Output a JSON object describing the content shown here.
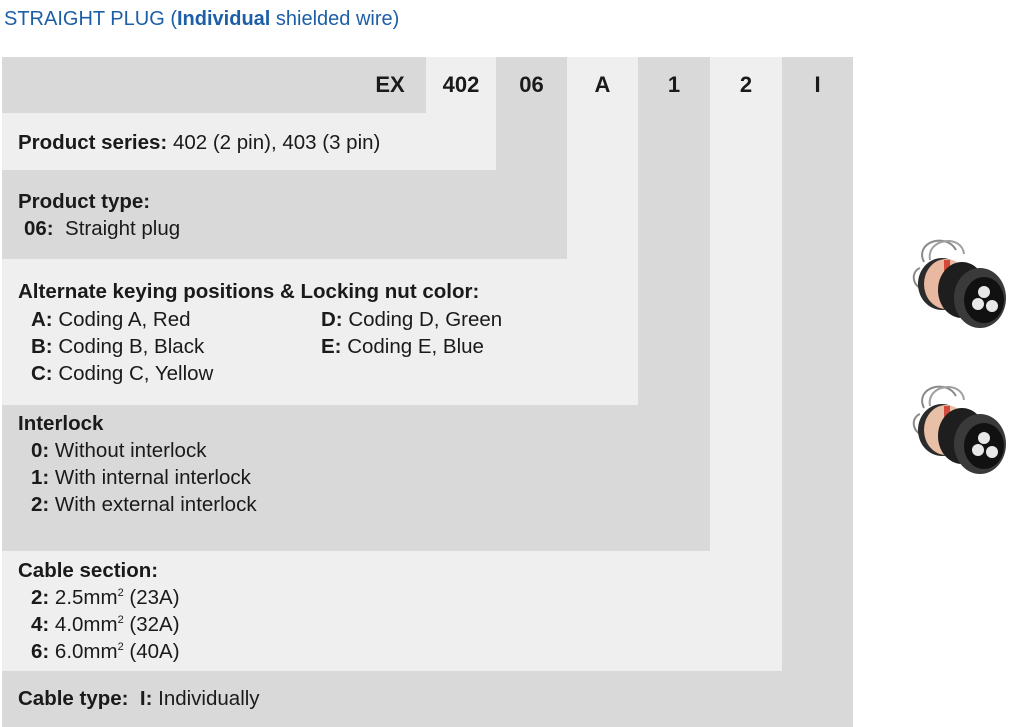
{
  "title": {
    "prefix": "STRAIGHT PLUG (",
    "bold": "Individual",
    "suffix": " shielded wire)"
  },
  "header": {
    "cells": [
      "EX",
      "402",
      "06",
      "A",
      "1",
      "2",
      "I"
    ]
  },
  "series": {
    "label": "Product series:",
    "value": " 402 (2 pin), 403 (3 pin)"
  },
  "type": {
    "label": "Product type:",
    "code": "06:",
    "desc": "  Straight plug"
  },
  "keying": {
    "heading": "Alternate keying positions & Locking nut color:",
    "left": [
      {
        "code": "A:",
        "desc": " Coding A, Red"
      },
      {
        "code": "B:",
        "desc": " Coding B, Black"
      },
      {
        "code": "C:",
        "desc": " Coding C, Yellow"
      }
    ],
    "right": [
      {
        "code": "D:",
        "desc": " Coding D, Green"
      },
      {
        "code": "E:",
        "desc": " Coding E, Blue"
      }
    ]
  },
  "interlock": {
    "heading": "Interlock",
    "items": [
      {
        "code": "0:",
        "desc": " Without interlock"
      },
      {
        "code": "1:",
        "desc": " With internal interlock"
      },
      {
        "code": "2:",
        "desc": " With external interlock"
      }
    ]
  },
  "cable_section": {
    "heading": "Cable section:",
    "items": [
      {
        "code": "2:",
        "pre": " 2.5mm",
        "sup": "2",
        "post": " (23A)"
      },
      {
        "code": "4:",
        "pre": " 4.0mm",
        "sup": "2",
        "post": " (32A)"
      },
      {
        "code": "6:",
        "pre": " 6.0mm",
        "sup": "2",
        "post": " (40A)"
      }
    ]
  },
  "cable_type": {
    "label": "Cable type:",
    "code": "I:",
    "desc": " Individually"
  },
  "images": [
    "connector-plug-image",
    "connector-plug-image"
  ]
}
